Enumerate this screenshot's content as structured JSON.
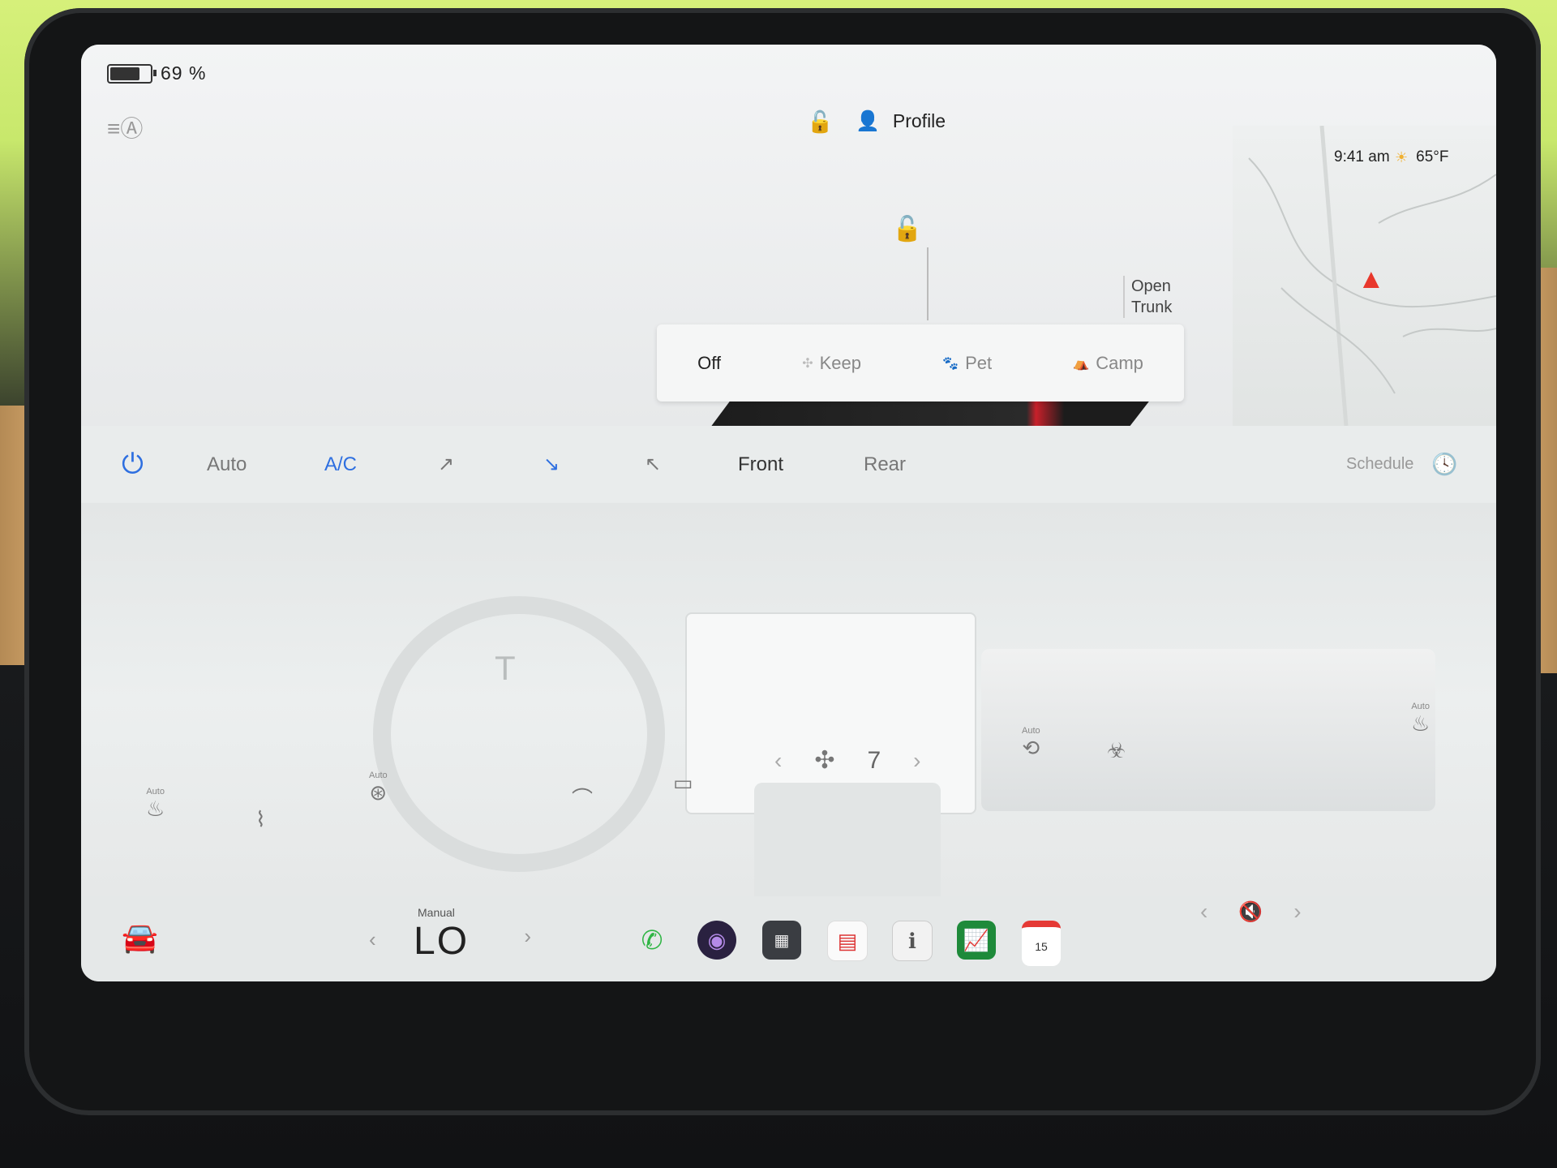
{
  "status_bar": {
    "battery_percent_text": "69 %",
    "battery_level": 0.69,
    "profile_label": "Profile",
    "time": "9:41 am",
    "temperature": "65°F"
  },
  "car_view": {
    "open_trunk_line1": "Open",
    "open_trunk_line2": "Trunk",
    "modes": [
      {
        "label": "Off",
        "active": true
      },
      {
        "label": "Keep",
        "active": false
      },
      {
        "label": "Pet",
        "active": false
      },
      {
        "label": "Camp",
        "active": false
      }
    ]
  },
  "climate_bar": {
    "auto_label": "Auto",
    "ac_label": "A/C",
    "front_label": "Front",
    "rear_label": "Rear",
    "schedule_label": "Schedule"
  },
  "controls": {
    "auto_label": "Auto",
    "fan_speed": "7"
  },
  "dock": {
    "temp_mode": "Manual",
    "temp_value": "LO",
    "calendar_day": "15"
  },
  "colors": {
    "accent_blue": "#2e6fe0",
    "phone_green": "#2fb544",
    "nav_red": "#e8382c",
    "calendar_red": "#e53935"
  }
}
